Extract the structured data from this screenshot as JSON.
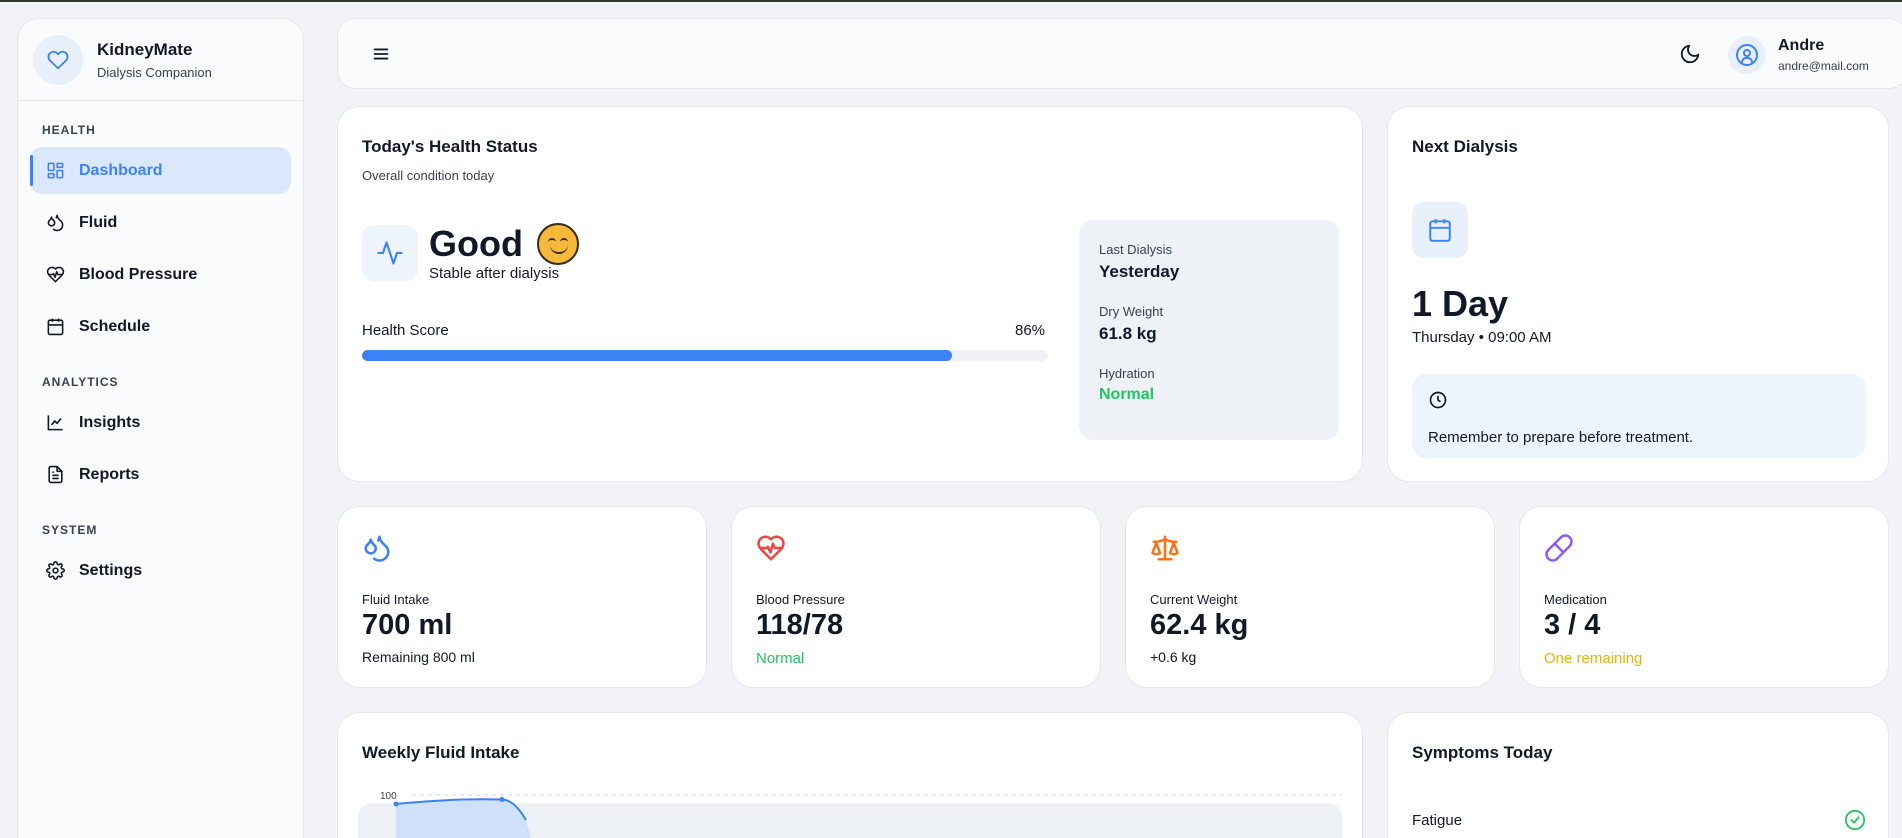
{
  "sidebar": {
    "brand_title": "KidneyMate",
    "brand_subtitle": "Dialysis Companion",
    "sections": {
      "health": "HEALTH",
      "analytics": "ANALYTICS",
      "system": "SYSTEM"
    },
    "items": {
      "dashboard": "Dashboard",
      "fluid": "Fluid",
      "blood_pressure": "Blood Pressure",
      "schedule": "Schedule",
      "insights": "Insights",
      "reports": "Reports",
      "settings": "Settings"
    },
    "active": "dashboard"
  },
  "header": {
    "user_name": "Andre",
    "user_email": "andre@mail.com"
  },
  "health_status": {
    "title": "Today's Health Status",
    "subtitle": "Overall condition today",
    "status": "Good",
    "status_sub": "Stable after dialysis",
    "score_label": "Health Score",
    "score_text": "86%",
    "score_value": 86,
    "last_dialysis_label": "Last Dialysis",
    "last_dialysis_value": "Yesterday",
    "dry_weight_label": "Dry Weight",
    "dry_weight_value": "61.8 kg",
    "hydration_label": "Hydration",
    "hydration_value": "Normal"
  },
  "next_dialysis": {
    "title": "Next Dialysis",
    "countdown": "1 Day",
    "when": "Thursday • 09:00 AM",
    "reminder": "Remember to prepare before treatment."
  },
  "stats": {
    "fluid": {
      "label": "Fluid Intake",
      "value": "700 ml",
      "sub": "Remaining 800 ml"
    },
    "bp": {
      "label": "Blood Pressure",
      "value": "118/78",
      "sub": "Normal"
    },
    "weight": {
      "label": "Current Weight",
      "value": "62.4 kg",
      "sub": "+0.6 kg"
    },
    "medication": {
      "label": "Medication",
      "value": "3 / 4",
      "sub": "One remaining"
    }
  },
  "weekly": {
    "title": "Weekly Fluid Intake"
  },
  "chart_data": {
    "type": "area",
    "title": "Weekly Fluid Intake",
    "y_tick_labels": [
      "100"
    ],
    "ylim": [
      0,
      100
    ],
    "values": [
      94,
      97,
      90
    ],
    "grid": true
  },
  "symptoms": {
    "title": "Symptoms Today",
    "items": [
      {
        "name": "Fatigue",
        "checked": true
      }
    ]
  },
  "colors": {
    "accent": "#3b82f6",
    "good": "#22c55e",
    "warning": "#eab308",
    "bp_icon": "#ef4444",
    "weight_icon": "#f97316",
    "med_icon": "#8b5cf6"
  }
}
